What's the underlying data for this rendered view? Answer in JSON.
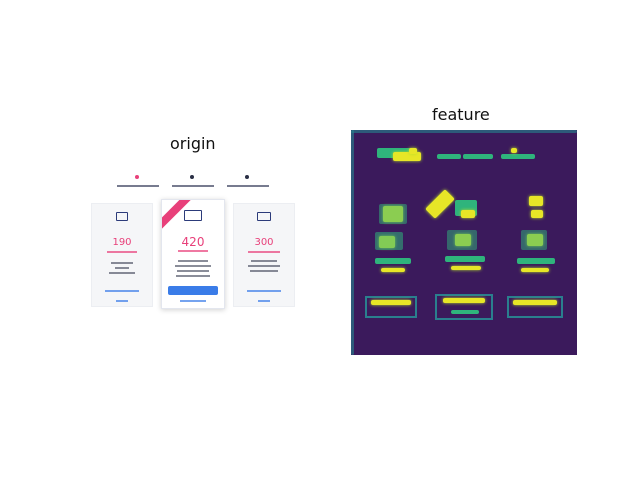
{
  "panels": {
    "left_title": "origin",
    "right_title": "feature"
  },
  "pricing": {
    "prices": [
      "190",
      "420",
      "300"
    ]
  },
  "colors": {
    "accent_pink": "#e8407a",
    "accent_blue": "#3a7ce8",
    "heatmap_bg": "#3b1a5c",
    "heatmap_hot": "#e7e627",
    "heatmap_warm": "#2fb47c"
  }
}
